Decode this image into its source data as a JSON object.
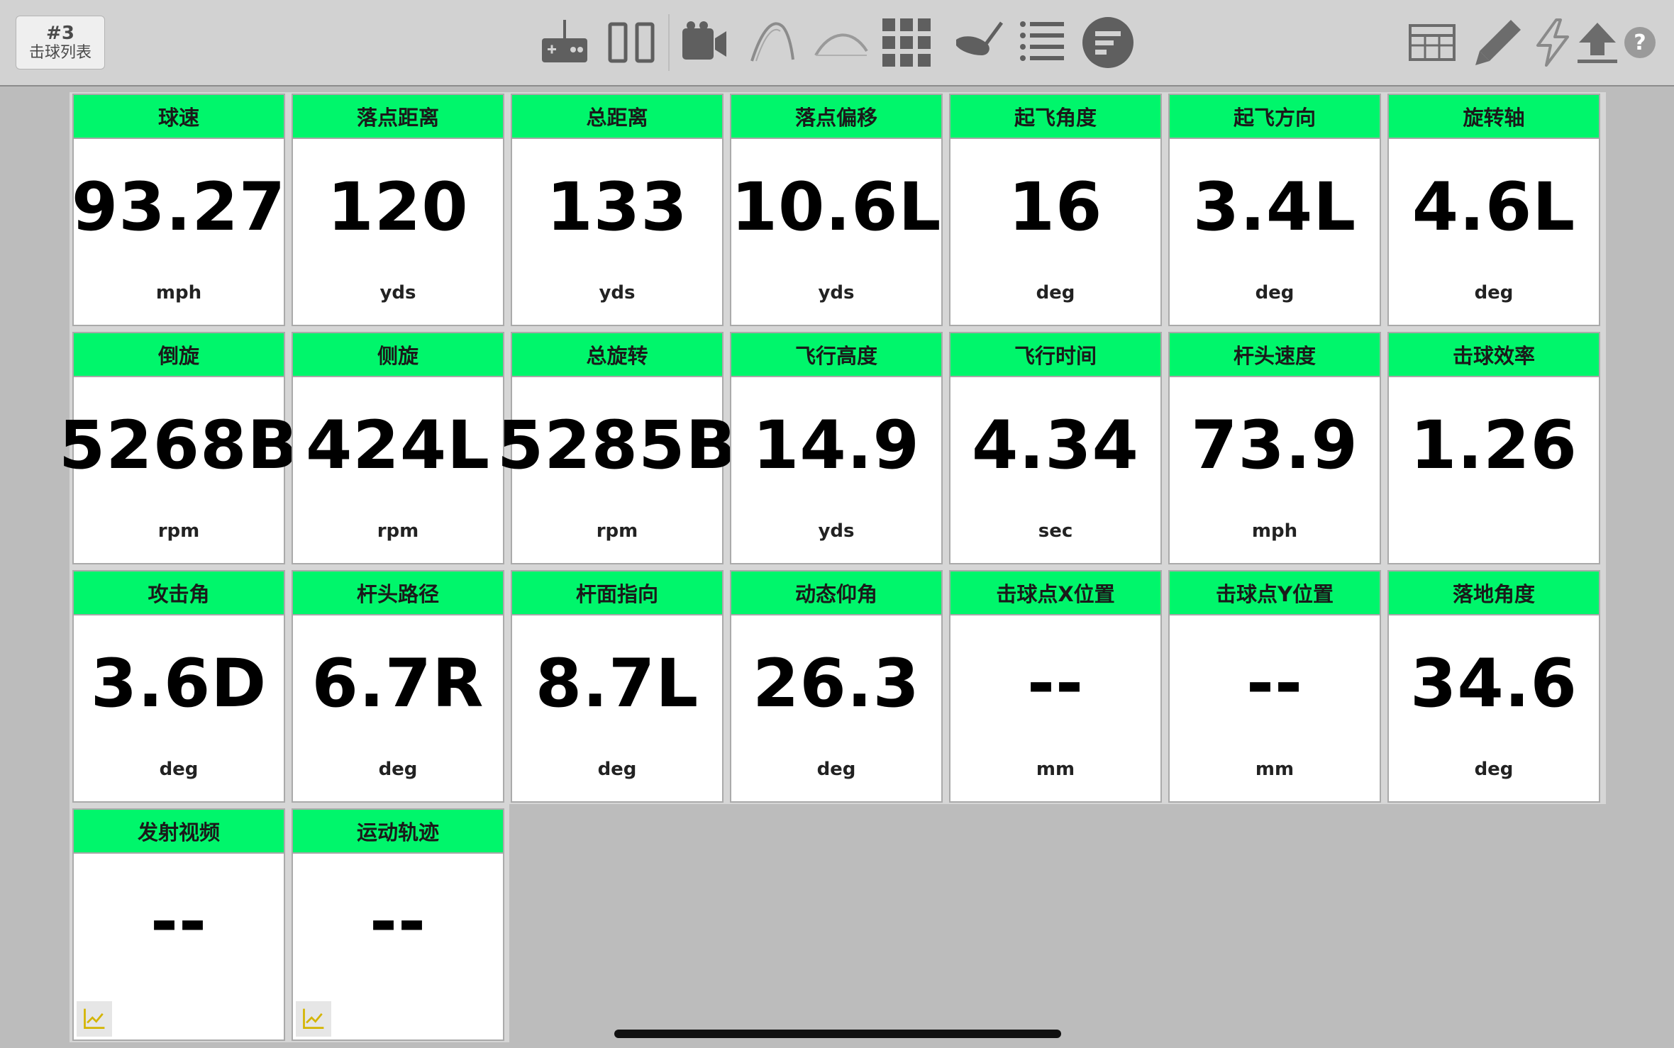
{
  "header": {
    "shot_number": "#3",
    "shot_list_label": "击球列表"
  },
  "toolbar": {
    "center_icons": [
      "remote-controller-icon",
      "split-view-icon",
      "video-camera-icon",
      "trajectory-side-icon",
      "trajectory-arc-icon",
      "grid-view-icon",
      "club-head-icon",
      "list-view-icon",
      "summary-icon"
    ],
    "right_icons": [
      "table-icon",
      "pencil-icon",
      "lightning-icon",
      "upload-icon",
      "help-icon"
    ],
    "help_symbol": "?"
  },
  "metrics": [
    {
      "label": "球速",
      "value": "93.27",
      "unit": "mph"
    },
    {
      "label": "落点距离",
      "value": "120",
      "unit": "yds"
    },
    {
      "label": "总距离",
      "value": "133",
      "unit": "yds"
    },
    {
      "label": "落点偏移",
      "value": "10.6L",
      "unit": "yds"
    },
    {
      "label": "起飞角度",
      "value": "16",
      "unit": "deg"
    },
    {
      "label": "起飞方向",
      "value": "3.4L",
      "unit": "deg"
    },
    {
      "label": "旋转轴",
      "value": "4.6L",
      "unit": "deg"
    },
    {
      "label": "倒旋",
      "value": "5268B",
      "unit": "rpm"
    },
    {
      "label": "侧旋",
      "value": "424L",
      "unit": "rpm"
    },
    {
      "label": "总旋转",
      "value": "5285B",
      "unit": "rpm"
    },
    {
      "label": "飞行高度",
      "value": "14.9",
      "unit": "yds"
    },
    {
      "label": "飞行时间",
      "value": "4.34",
      "unit": "sec"
    },
    {
      "label": "杆头速度",
      "value": "73.9",
      "unit": "mph"
    },
    {
      "label": "击球效率",
      "value": "1.26",
      "unit": ""
    },
    {
      "label": "攻击角",
      "value": "3.6D",
      "unit": "deg"
    },
    {
      "label": "杆头路径",
      "value": "6.7R",
      "unit": "deg"
    },
    {
      "label": "杆面指向",
      "value": "8.7L",
      "unit": "deg"
    },
    {
      "label": "动态仰角",
      "value": "26.3",
      "unit": "deg"
    },
    {
      "label": "击球点X位置",
      "value": "--",
      "unit": "mm"
    },
    {
      "label": "击球点Y位置",
      "value": "--",
      "unit": "mm"
    },
    {
      "label": "落地角度",
      "value": "34.6",
      "unit": "deg"
    },
    {
      "label": "发射视频",
      "value": "--",
      "unit": "",
      "icon": "chart-icon"
    },
    {
      "label": "运动轨迹",
      "value": "--",
      "unit": "",
      "icon": "chart-icon"
    }
  ],
  "colors": {
    "header_green": "#00f66b",
    "background": "#bcbcbc",
    "toolbar": "#d2d2d2",
    "icon_gray": "#5f5f5f",
    "chart_icon_yellow": "#d4b400"
  }
}
